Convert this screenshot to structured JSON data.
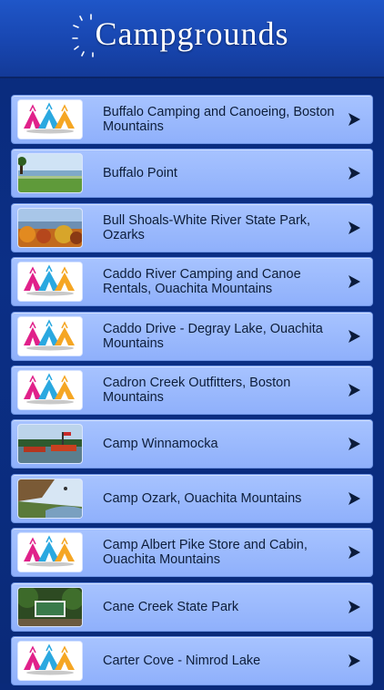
{
  "header": {
    "title": "Campgrounds"
  },
  "campgrounds": [
    {
      "name": "Buffalo Camping and Canoeing, Boston Mountains",
      "thumb": "tent-logo"
    },
    {
      "name": "Buffalo Point",
      "thumb": "lake-photo"
    },
    {
      "name": "Bull Shoals-White River State Park, Ozarks",
      "thumb": "autumn-photo"
    },
    {
      "name": "Caddo River Camping and Canoe Rentals, Ouachita Mountains",
      "thumb": "tent-logo"
    },
    {
      "name": "Caddo Drive - Degray Lake, Ouachita Mountains",
      "thumb": "tent-logo"
    },
    {
      "name": "Cadron Creek Outfitters, Boston Mountains",
      "thumb": "tent-logo"
    },
    {
      "name": "Camp Winnamocka",
      "thumb": "boats-photo"
    },
    {
      "name": "Camp Ozark, Ouachita Mountains",
      "thumb": "cliff-photo"
    },
    {
      "name": "Camp Albert Pike Store and Cabin, Ouachita Mountains",
      "thumb": "tent-logo"
    },
    {
      "name": "Cane Creek State Park",
      "thumb": "sign-photo"
    },
    {
      "name": "Carter Cove - Nimrod Lake",
      "thumb": "tent-logo"
    }
  ]
}
